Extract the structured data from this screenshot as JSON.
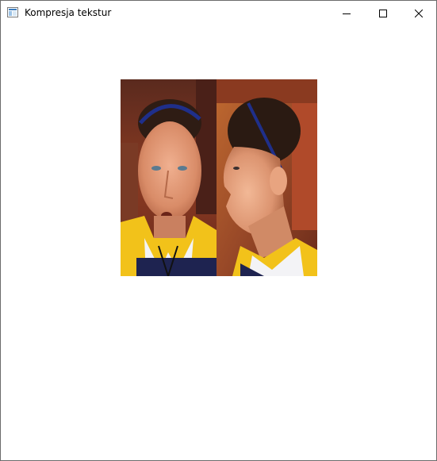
{
  "window": {
    "title": "Kompresja tekstur",
    "icon": "app-window-icon",
    "controls": {
      "minimize": "minimize-icon",
      "maximize": "maximize-icon",
      "close": "close-icon"
    }
  },
  "content": {
    "image": "texture-image",
    "panels": [
      "front-face-photo",
      "profile-face-photo"
    ]
  },
  "colors": {
    "jersey_yellow": "#f2c21a",
    "jersey_navy": "#1e2350",
    "skin": "#e0a07a",
    "hair": "#3a2418"
  }
}
